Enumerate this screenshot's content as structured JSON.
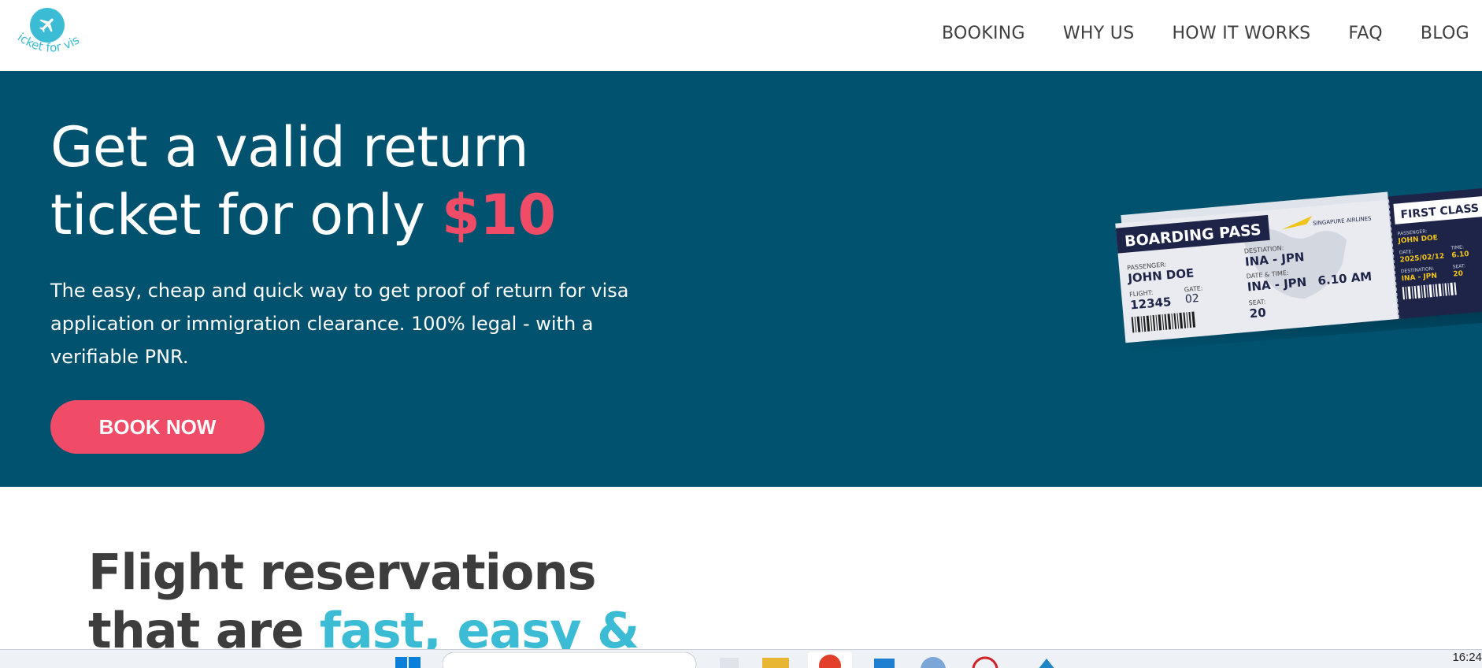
{
  "brand": {
    "logo_text": "ticket for visa",
    "color": "#3bbcd4"
  },
  "nav": {
    "items": [
      {
        "label": "BOOKING"
      },
      {
        "label": "WHY US"
      },
      {
        "label": "HOW IT WORKS"
      },
      {
        "label": "FAQ"
      },
      {
        "label": "BLOG"
      }
    ]
  },
  "hero": {
    "title_line1": "Get a valid return",
    "title_line2": "ticket for only ",
    "price": "$10",
    "subtitle": "The easy, cheap and quick way to get proof of return for visa application or immigration clearance. 100% legal - with a verifiable PNR.",
    "cta_label": "BOOK NOW",
    "background": "#00526f",
    "accent": "#f04c68"
  },
  "boarding_pass": {
    "heading": "BOARDING PASS",
    "airline": "SINGAPURE AIRLINES",
    "passenger_label": "PASSENGER:",
    "passenger": "JOHN DOE",
    "flight_label": "FLIGHT:",
    "flight": "12345",
    "gate_label": "GATE:",
    "gate": "02",
    "destination_label": "DESTIATION:",
    "destination": "INA - JPN",
    "datetime_label": "DATE & TIME:",
    "datetime_route": "INA - JPN",
    "time": "6.10 AM",
    "seat_label": "SEAT:",
    "seat": "20",
    "stub_heading": "FIRST CLASS",
    "stub_passenger_label": "PASSENGER:",
    "stub_passenger": "JOHN DOE",
    "stub_date_label": "DATE:",
    "stub_date": "2025/02/12",
    "stub_time_label": "TIME:",
    "stub_time": "6.10",
    "stub_destination_label": "DESTINATION:",
    "stub_destination": "INA - JPN",
    "stub_seat_label": "SEAT:",
    "stub_seat": "20"
  },
  "section": {
    "title_line1": "Flight reservations",
    "title_line2": "that are ",
    "title_accent": "fast, easy &"
  },
  "taskbar": {
    "clock": "16:24"
  }
}
